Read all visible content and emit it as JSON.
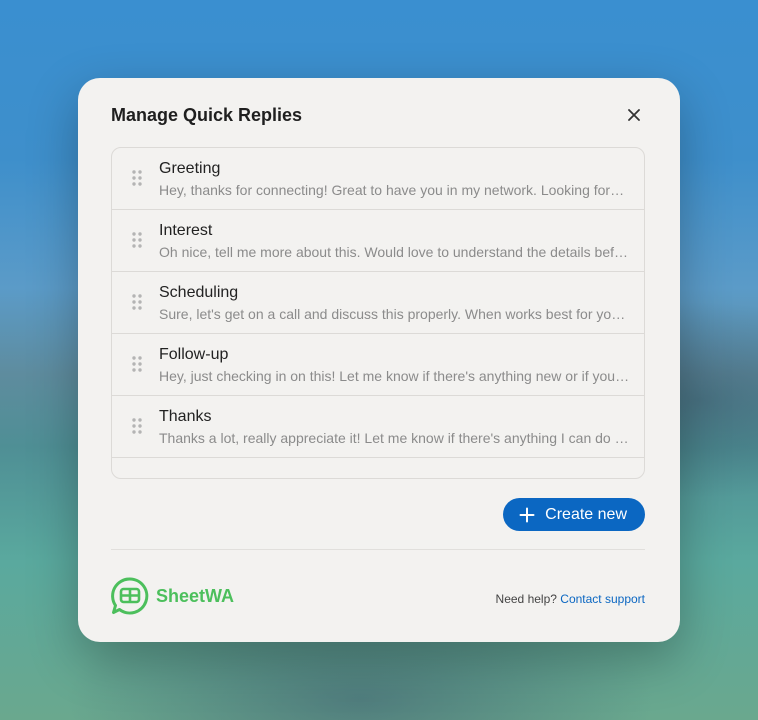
{
  "dialog": {
    "title": "Manage Quick Replies",
    "close_icon": "close-icon"
  },
  "replies": [
    {
      "title": "Greeting",
      "text": "Hey, thanks for connecting! Great to have you in my network. Looking forward to connecting more."
    },
    {
      "title": "Interest",
      "text": "Oh nice, tell me more about this. Would love to understand the details before we proceed."
    },
    {
      "title": "Scheduling",
      "text": "Sure, let's get on a call and discuss this properly. When works best for you this week?"
    },
    {
      "title": "Follow-up",
      "text": "Hey, just checking in on this! Let me know if there's anything new or if you need anything."
    },
    {
      "title": "Thanks",
      "text": "Thanks a lot, really appreciate it! Let me know if there's anything I can do for you."
    }
  ],
  "actions": {
    "create_label": "Create new"
  },
  "footer": {
    "brand": "SheetWA",
    "help_text": "Need help?",
    "support_link": "Contact support"
  },
  "colors": {
    "accent": "#0b67c2",
    "brand": "#4cbf5c"
  }
}
